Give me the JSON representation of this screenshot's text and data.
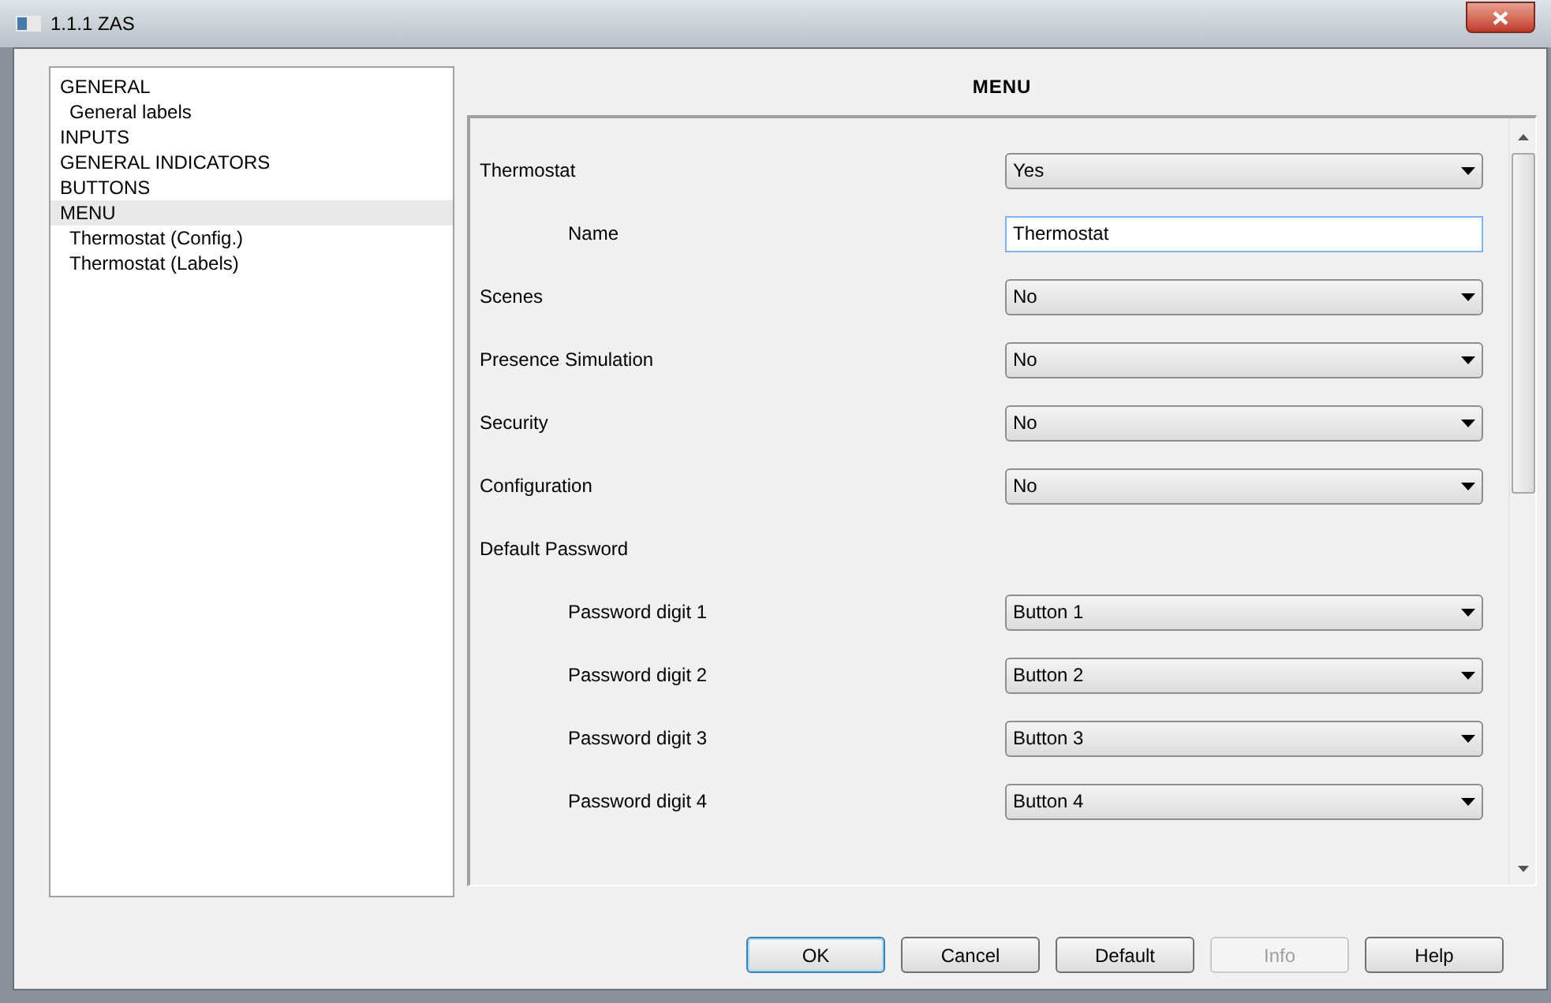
{
  "window": {
    "title": "1.1.1 ZAS"
  },
  "tree": [
    {
      "label": "GENERAL",
      "selected": false,
      "children": [
        {
          "label": "General labels",
          "selected": false
        }
      ]
    },
    {
      "label": "INPUTS",
      "selected": false
    },
    {
      "label": "GENERAL INDICATORS",
      "selected": false
    },
    {
      "label": "BUTTONS",
      "selected": false
    },
    {
      "label": "MENU",
      "selected": true,
      "children": [
        {
          "label": "Thermostat (Config.)",
          "selected": false
        },
        {
          "label": "Thermostat (Labels)",
          "selected": false
        }
      ]
    }
  ],
  "panel": {
    "title": "MENU"
  },
  "rows": [
    {
      "kind": "select",
      "label": "Thermostat",
      "value": "Yes",
      "children": [
        {
          "kind": "text",
          "label": "Name",
          "value": "Thermostat"
        }
      ]
    },
    {
      "kind": "select",
      "label": "Scenes",
      "value": "No"
    },
    {
      "kind": "select",
      "label": "Presence Simulation",
      "value": "No"
    },
    {
      "kind": "select",
      "label": "Security",
      "value": "No"
    },
    {
      "kind": "select",
      "label": "Configuration",
      "value": "No"
    },
    {
      "kind": "heading",
      "label": "Default Password",
      "children": [
        {
          "kind": "select",
          "label": "Password digit 1",
          "value": "Button 1"
        },
        {
          "kind": "select",
          "label": "Password digit 2",
          "value": "Button 2"
        },
        {
          "kind": "select",
          "label": "Password digit 3",
          "value": "Button 3"
        },
        {
          "kind": "select",
          "label": "Password digit 4",
          "value": "Button 4"
        }
      ]
    }
  ],
  "buttons": [
    {
      "label": "OK",
      "focused": true,
      "disabled": false
    },
    {
      "label": "Cancel",
      "focused": false,
      "disabled": false
    },
    {
      "label": "Default",
      "focused": false,
      "disabled": false
    },
    {
      "label": "Info",
      "focused": false,
      "disabled": true
    },
    {
      "label": "Help",
      "focused": false,
      "disabled": false
    }
  ]
}
